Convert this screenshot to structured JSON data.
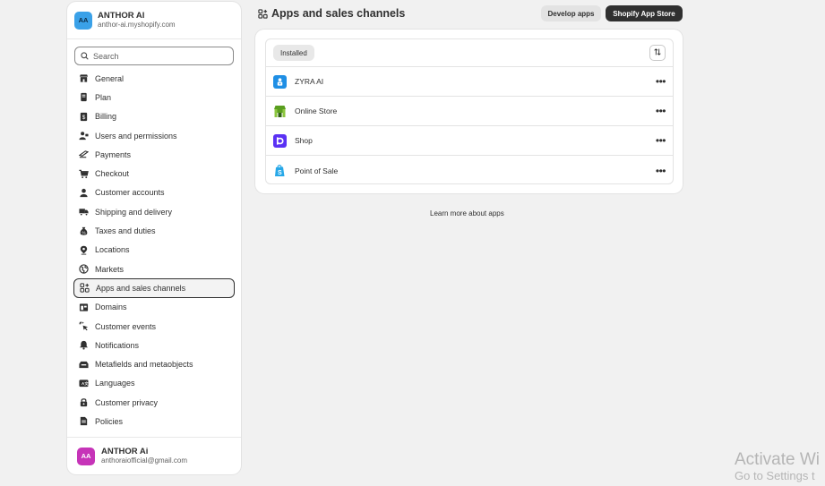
{
  "store": {
    "initials": "AA",
    "name": "ANTHOR AI",
    "domain": "anthor-ai.myshopify.com"
  },
  "search": {
    "placeholder": "Search"
  },
  "nav": [
    {
      "label": "General",
      "icon": "store-icon"
    },
    {
      "label": "Plan",
      "icon": "plan-icon"
    },
    {
      "label": "Billing",
      "icon": "billing-icon"
    },
    {
      "label": "Users and permissions",
      "icon": "users-icon"
    },
    {
      "label": "Payments",
      "icon": "payments-icon"
    },
    {
      "label": "Checkout",
      "icon": "cart-icon"
    },
    {
      "label": "Customer accounts",
      "icon": "person-icon"
    },
    {
      "label": "Shipping and delivery",
      "icon": "truck-icon"
    },
    {
      "label": "Taxes and duties",
      "icon": "tax-icon"
    },
    {
      "label": "Locations",
      "icon": "location-icon"
    },
    {
      "label": "Markets",
      "icon": "globe-icon"
    },
    {
      "label": "Apps and sales channels",
      "icon": "apps-icon",
      "active": true
    },
    {
      "label": "Domains",
      "icon": "domain-icon"
    },
    {
      "label": "Customer events",
      "icon": "events-icon"
    },
    {
      "label": "Notifications",
      "icon": "bell-icon"
    },
    {
      "label": "Metafields and metaobjects",
      "icon": "metafields-icon"
    },
    {
      "label": "Languages",
      "icon": "language-icon"
    },
    {
      "label": "Customer privacy",
      "icon": "lock-icon"
    },
    {
      "label": "Policies",
      "icon": "policies-icon"
    }
  ],
  "user": {
    "initials": "AA",
    "name": "ANTHOR Ai",
    "email": "anthoraiofficial@gmail.com"
  },
  "main": {
    "title": "Apps and sales channels",
    "develop_apps_label": "Develop apps",
    "app_store_label": "Shopify App Store",
    "filter_chip": "Installed",
    "apps": [
      {
        "name": "ZYRA AI",
        "icon": "zyra-ai-icon",
        "color": "#1f8fe5"
      },
      {
        "name": "Online Store",
        "icon": "online-store-icon",
        "color": "#5a9e1f"
      },
      {
        "name": "Shop",
        "icon": "shop-icon",
        "color": "#5a31f4"
      },
      {
        "name": "Point of Sale",
        "icon": "point-of-sale-icon",
        "color": "#27a8e8"
      }
    ],
    "learn_more": "Learn more about apps"
  },
  "watermark": {
    "line1": "Activate Wi",
    "line2": "Go to Settings t"
  }
}
